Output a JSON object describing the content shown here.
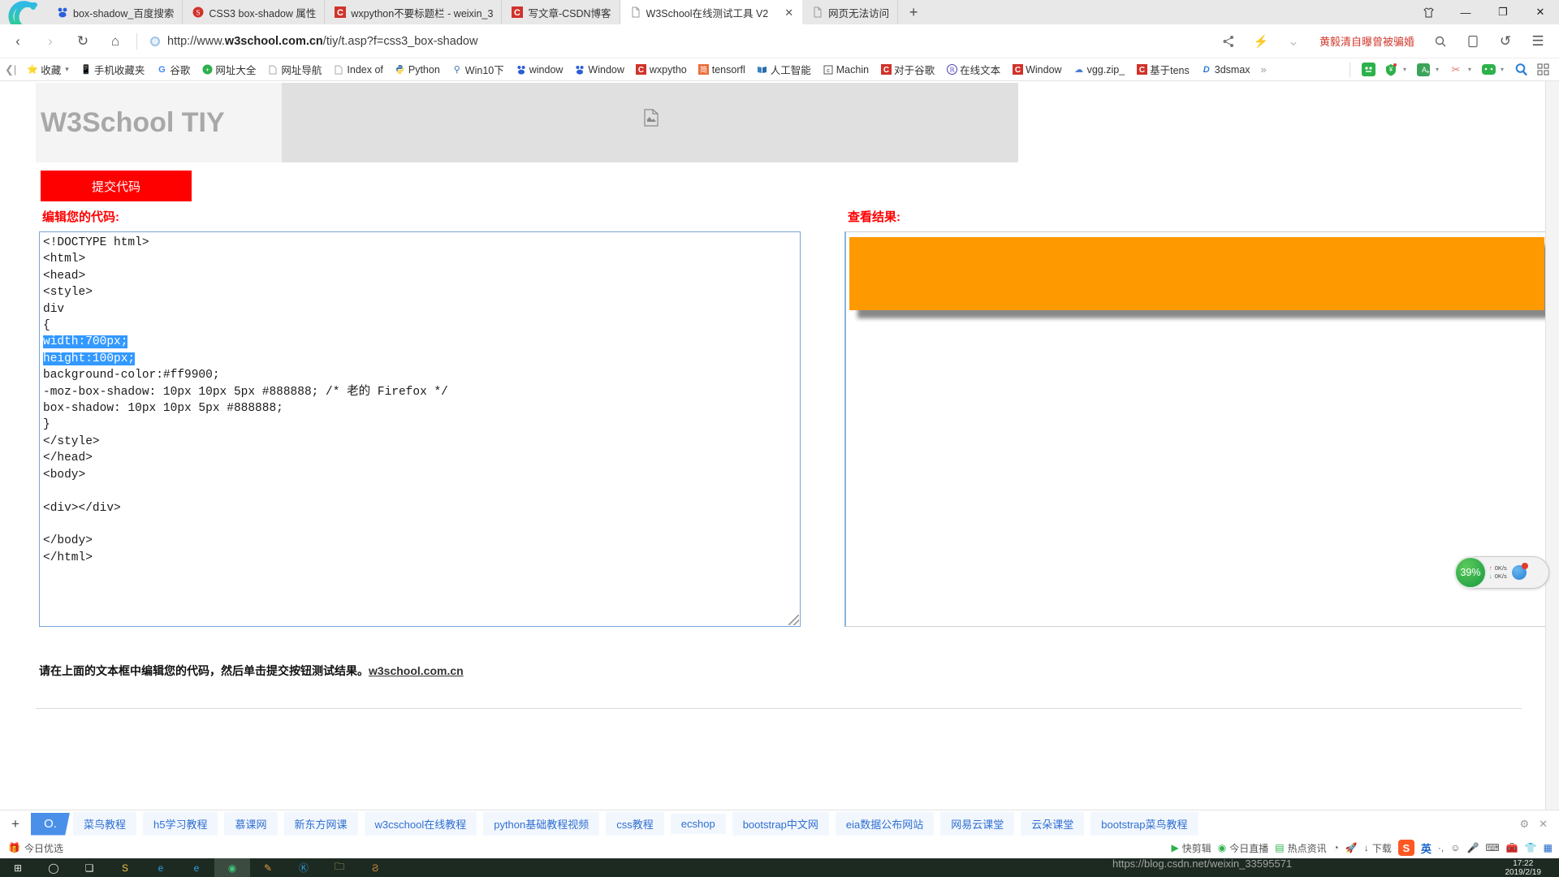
{
  "browser": {
    "tabs": [
      {
        "title": "box-shadow_百度搜索",
        "icon": "baidu-favicon",
        "active": false
      },
      {
        "title": "CSS3 box-shadow 属性",
        "icon": "w3school-favicon",
        "active": false
      },
      {
        "title": "wxpython不要标题栏 - weixin_3",
        "icon": "csdn-favicon",
        "active": false
      },
      {
        "title": "写文章-CSDN博客",
        "icon": "csdn-favicon",
        "active": false
      },
      {
        "title": "W3School在线测试工具 V2",
        "icon": "page-favicon",
        "active": true
      },
      {
        "title": "网页无法访问",
        "icon": "page-favicon",
        "active": false
      }
    ],
    "new_tab_label": "+",
    "close_label": "✕",
    "window_controls": {
      "skin": "shirt-icon",
      "minimize": "—",
      "maximize": "❐",
      "close": "✕"
    },
    "nav": {
      "back": "‹",
      "forward": "›",
      "reload": "↻",
      "home": "⌂",
      "url_prefix": "http://www.",
      "url_domain": "w3school.com.cn",
      "url_path": "/tiy/t.asp?f=css3_box-shadow",
      "promo_text": "黄毅清自曝曾被骗婚",
      "share": "share-icon",
      "bolt": "bolt-icon",
      "chevron": "⌄",
      "search": "search-icon",
      "tablet": "tablet-icon",
      "undo": "↺",
      "menu": "☰"
    },
    "bookmarks": {
      "back_chevron": "❮|",
      "items": [
        {
          "label": "收藏",
          "icon": "star-icon",
          "has_caret": true
        },
        {
          "label": "手机收藏夹",
          "icon": "phone-icon"
        },
        {
          "label": "谷歌",
          "icon": "google-icon"
        },
        {
          "label": "网址大全",
          "icon": "hao123-icon"
        },
        {
          "label": "网址导航",
          "icon": "page-icon"
        },
        {
          "label": "Index of",
          "icon": "page-icon"
        },
        {
          "label": "Python",
          "icon": "python-icon"
        },
        {
          "label": "Win10下",
          "icon": "win-icon"
        },
        {
          "label": "window",
          "icon": "baidu-icon"
        },
        {
          "label": "Window",
          "icon": "baidu-icon"
        },
        {
          "label": "wxpytho",
          "icon": "csdn-icon"
        },
        {
          "label": "tensorfl",
          "icon": "jian-icon"
        },
        {
          "label": "人工智能",
          "icon": "book-icon"
        },
        {
          "label": "Machin",
          "icon": "doc-icon"
        },
        {
          "label": "对于谷歌",
          "icon": "csdn-icon"
        },
        {
          "label": "在线文本",
          "icon": "circle-icon"
        },
        {
          "label": "Window",
          "icon": "csdn-icon"
        },
        {
          "label": "vgg.zip_",
          "icon": "cloud-icon"
        },
        {
          "label": "基于tens",
          "icon": "csdn-icon"
        },
        {
          "label": "3dsmax",
          "icon": "d-icon"
        }
      ],
      "overflow": "»",
      "tools": [
        "game-icon",
        "wallet-icon",
        "translate-icon",
        "scissors-icon",
        "gamepad-icon",
        "magnifier-icon",
        "apps-icon"
      ]
    }
  },
  "sidebar": {
    "items": [
      {
        "name": "favorites-star",
        "glyph": "★",
        "color": "#f5a623"
      },
      {
        "name": "notes",
        "glyph": "▤",
        "color": "#3c8fe0"
      },
      {
        "name": "weibo",
        "glyph": "◉",
        "color": "#e8593b"
      },
      {
        "name": "mail",
        "glyph": "@",
        "color": "#e8452c"
      }
    ]
  },
  "tiy": {
    "title": "W3School TIY",
    "broken_image_icon": "broken-image-icon",
    "submit_button": "提交代码",
    "editor_label": "编辑您的代码:",
    "result_label": "查看结果:",
    "code_lines": [
      {
        "text": "<!DOCTYPE html>",
        "selected": false
      },
      {
        "text": "<html>",
        "selected": false
      },
      {
        "text": "<head>",
        "selected": false
      },
      {
        "text": "<style>",
        "selected": false
      },
      {
        "text": "div",
        "selected": false
      },
      {
        "text": "{",
        "selected": false
      },
      {
        "text": "width:700px;",
        "selected": true
      },
      {
        "text": "height:100px;",
        "selected": true
      },
      {
        "text": "background-color:#ff9900;",
        "selected": false
      },
      {
        "text": "-moz-box-shadow: 10px 10px 5px #888888; /* 老的 Firefox */",
        "selected": false
      },
      {
        "text": "box-shadow: 10px 10px 5px #888888;",
        "selected": false
      },
      {
        "text": "}",
        "selected": false
      },
      {
        "text": "</style>",
        "selected": false
      },
      {
        "text": "</head>",
        "selected": false
      },
      {
        "text": "<body>",
        "selected": false
      },
      {
        "text": "",
        "selected": false
      },
      {
        "text": "<div></div>",
        "selected": false
      },
      {
        "text": "",
        "selected": false
      },
      {
        "text": "</body>",
        "selected": false
      },
      {
        "text": "</html>",
        "selected": false
      }
    ],
    "result_box": {
      "background_color": "#ff9900",
      "box_shadow": "10px 10px 5px #888888"
    },
    "note_text": "请在上面的文本框中编辑您的代码，然后单击提交按钮测试结果。",
    "note_link": "w3school.com.cn"
  },
  "speed_widget": {
    "percent": "39%",
    "up_rate": "0K/s",
    "down_rate": "0K/s",
    "up_arrow": "↑",
    "down_arrow": "↓"
  },
  "hotbar": {
    "plus": "+",
    "logo": "O.",
    "items": [
      "菜鸟教程",
      "h5学习教程",
      "慕课网",
      "新东方网课",
      "w3cschool在线教程",
      "python基础教程视频",
      "css教程",
      "ecshop",
      "bootstrap中文网",
      "eia数据公布网站",
      "网易云课堂",
      "云朵课堂",
      "bootstrap菜鸟教程"
    ],
    "gear": "gear-icon",
    "close": "✕"
  },
  "tray": {
    "left_label": "今日优选",
    "left_icon": "gift-icon",
    "items": [
      {
        "label": "快剪辑",
        "icon": "play-icon"
      },
      {
        "label": "今日直播",
        "icon": "live-icon"
      },
      {
        "label": "热点资讯",
        "icon": "news-icon"
      },
      {
        "label": "",
        "icon": "clock-icon"
      },
      {
        "label": "",
        "icon": "rocket-icon"
      },
      {
        "label": "下载",
        "icon": "download-icon"
      }
    ],
    "ime": {
      "logo": "S",
      "mode": "英",
      "punct": "·,",
      "emoji": "☺",
      "mic": "mic-icon",
      "keyboard": "keyboard-icon",
      "toolbox": "toolbox-icon",
      "skin": "shirt-icon",
      "apps": "apps-icon"
    }
  },
  "taskbar": {
    "items": [
      {
        "name": "start-button",
        "glyph": "⊞"
      },
      {
        "name": "cortana-search",
        "glyph": "◯"
      },
      {
        "name": "task-view",
        "glyph": "❏"
      },
      {
        "name": "sogou-pinyin",
        "glyph": "S"
      },
      {
        "name": "ie-browser",
        "glyph": "e"
      },
      {
        "name": "edge-browser",
        "glyph": "e"
      },
      {
        "name": "360-browser",
        "glyph": "◉"
      },
      {
        "name": "editor-app",
        "glyph": "✎"
      },
      {
        "name": "kugou-app",
        "glyph": "K"
      },
      {
        "name": "file-explorer",
        "glyph": "📁"
      },
      {
        "name": "sublime-app",
        "glyph": "S"
      }
    ],
    "clock_time": "17:22",
    "clock_date": "2019/2/19"
  },
  "watermark": {
    "line1": "https://blog.csdn.net/weixin_33595571"
  }
}
